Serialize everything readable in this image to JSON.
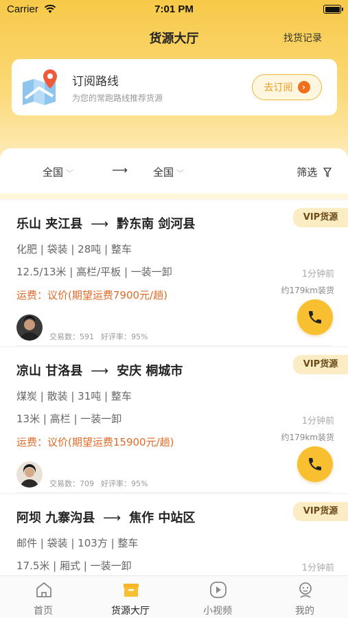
{
  "status_bar": {
    "carrier": "Carrier",
    "time": "7:01 PM"
  },
  "nav": {
    "title": "货源大厅",
    "right_link": "找货记录"
  },
  "subscribe": {
    "title": "订阅路线",
    "desc": "为您的常跑路线推荐货源",
    "button": "去订阅",
    "icon": "map-pin-icon"
  },
  "filter": {
    "from": "全国",
    "to": "全国",
    "arrow": "⟶",
    "screen": "筛选"
  },
  "cards": [
    {
      "from": "乐山 夹江县",
      "to": "黔东南 剑河县",
      "badge": "VIP货源",
      "line1": "化肥 | 袋装 |  28吨 | 整车",
      "line2": "12.5/13米 | 高栏/平板 | 一装一卸",
      "fee": "运费：议价(期望运费7900元/趟)",
      "time": "1分钟前",
      "distance": "约179km装货",
      "trades": "交易数：591",
      "rating": "好评率：95%"
    },
    {
      "from": "凉山 甘洛县",
      "to": "安庆 桐城市",
      "badge": "VIP货源",
      "line1": "煤炭 | 散装 |  31吨 | 整车",
      "line2": "13米 | 高栏 | 一装一卸",
      "fee": "运费：议价(期望运费15900元/趟)",
      "time": "1分钟前",
      "distance": "约179km装货",
      "trades": "交易数：709",
      "rating": "好评率：95%"
    },
    {
      "from": "阿坝 九寨沟县",
      "to": "焦作 中站区",
      "badge": "VIP货源",
      "line1": "邮件 | 袋装 |  103方 | 整车",
      "line2": "17.5米 | 厢式 | 一装一卸",
      "fee": "",
      "time": "1分钟前",
      "distance": "",
      "trades": "",
      "rating": ""
    }
  ],
  "tabs": [
    {
      "label": "首页",
      "icon": "home-icon"
    },
    {
      "label": "货源大厅",
      "icon": "cargo-box-icon",
      "active": true
    },
    {
      "label": "小视频",
      "icon": "video-icon"
    },
    {
      "label": "我的",
      "icon": "profile-icon"
    }
  ],
  "colors": {
    "accent": "#f8c031",
    "fee": "#e06a27",
    "vip_bg": "#fcecc4"
  }
}
